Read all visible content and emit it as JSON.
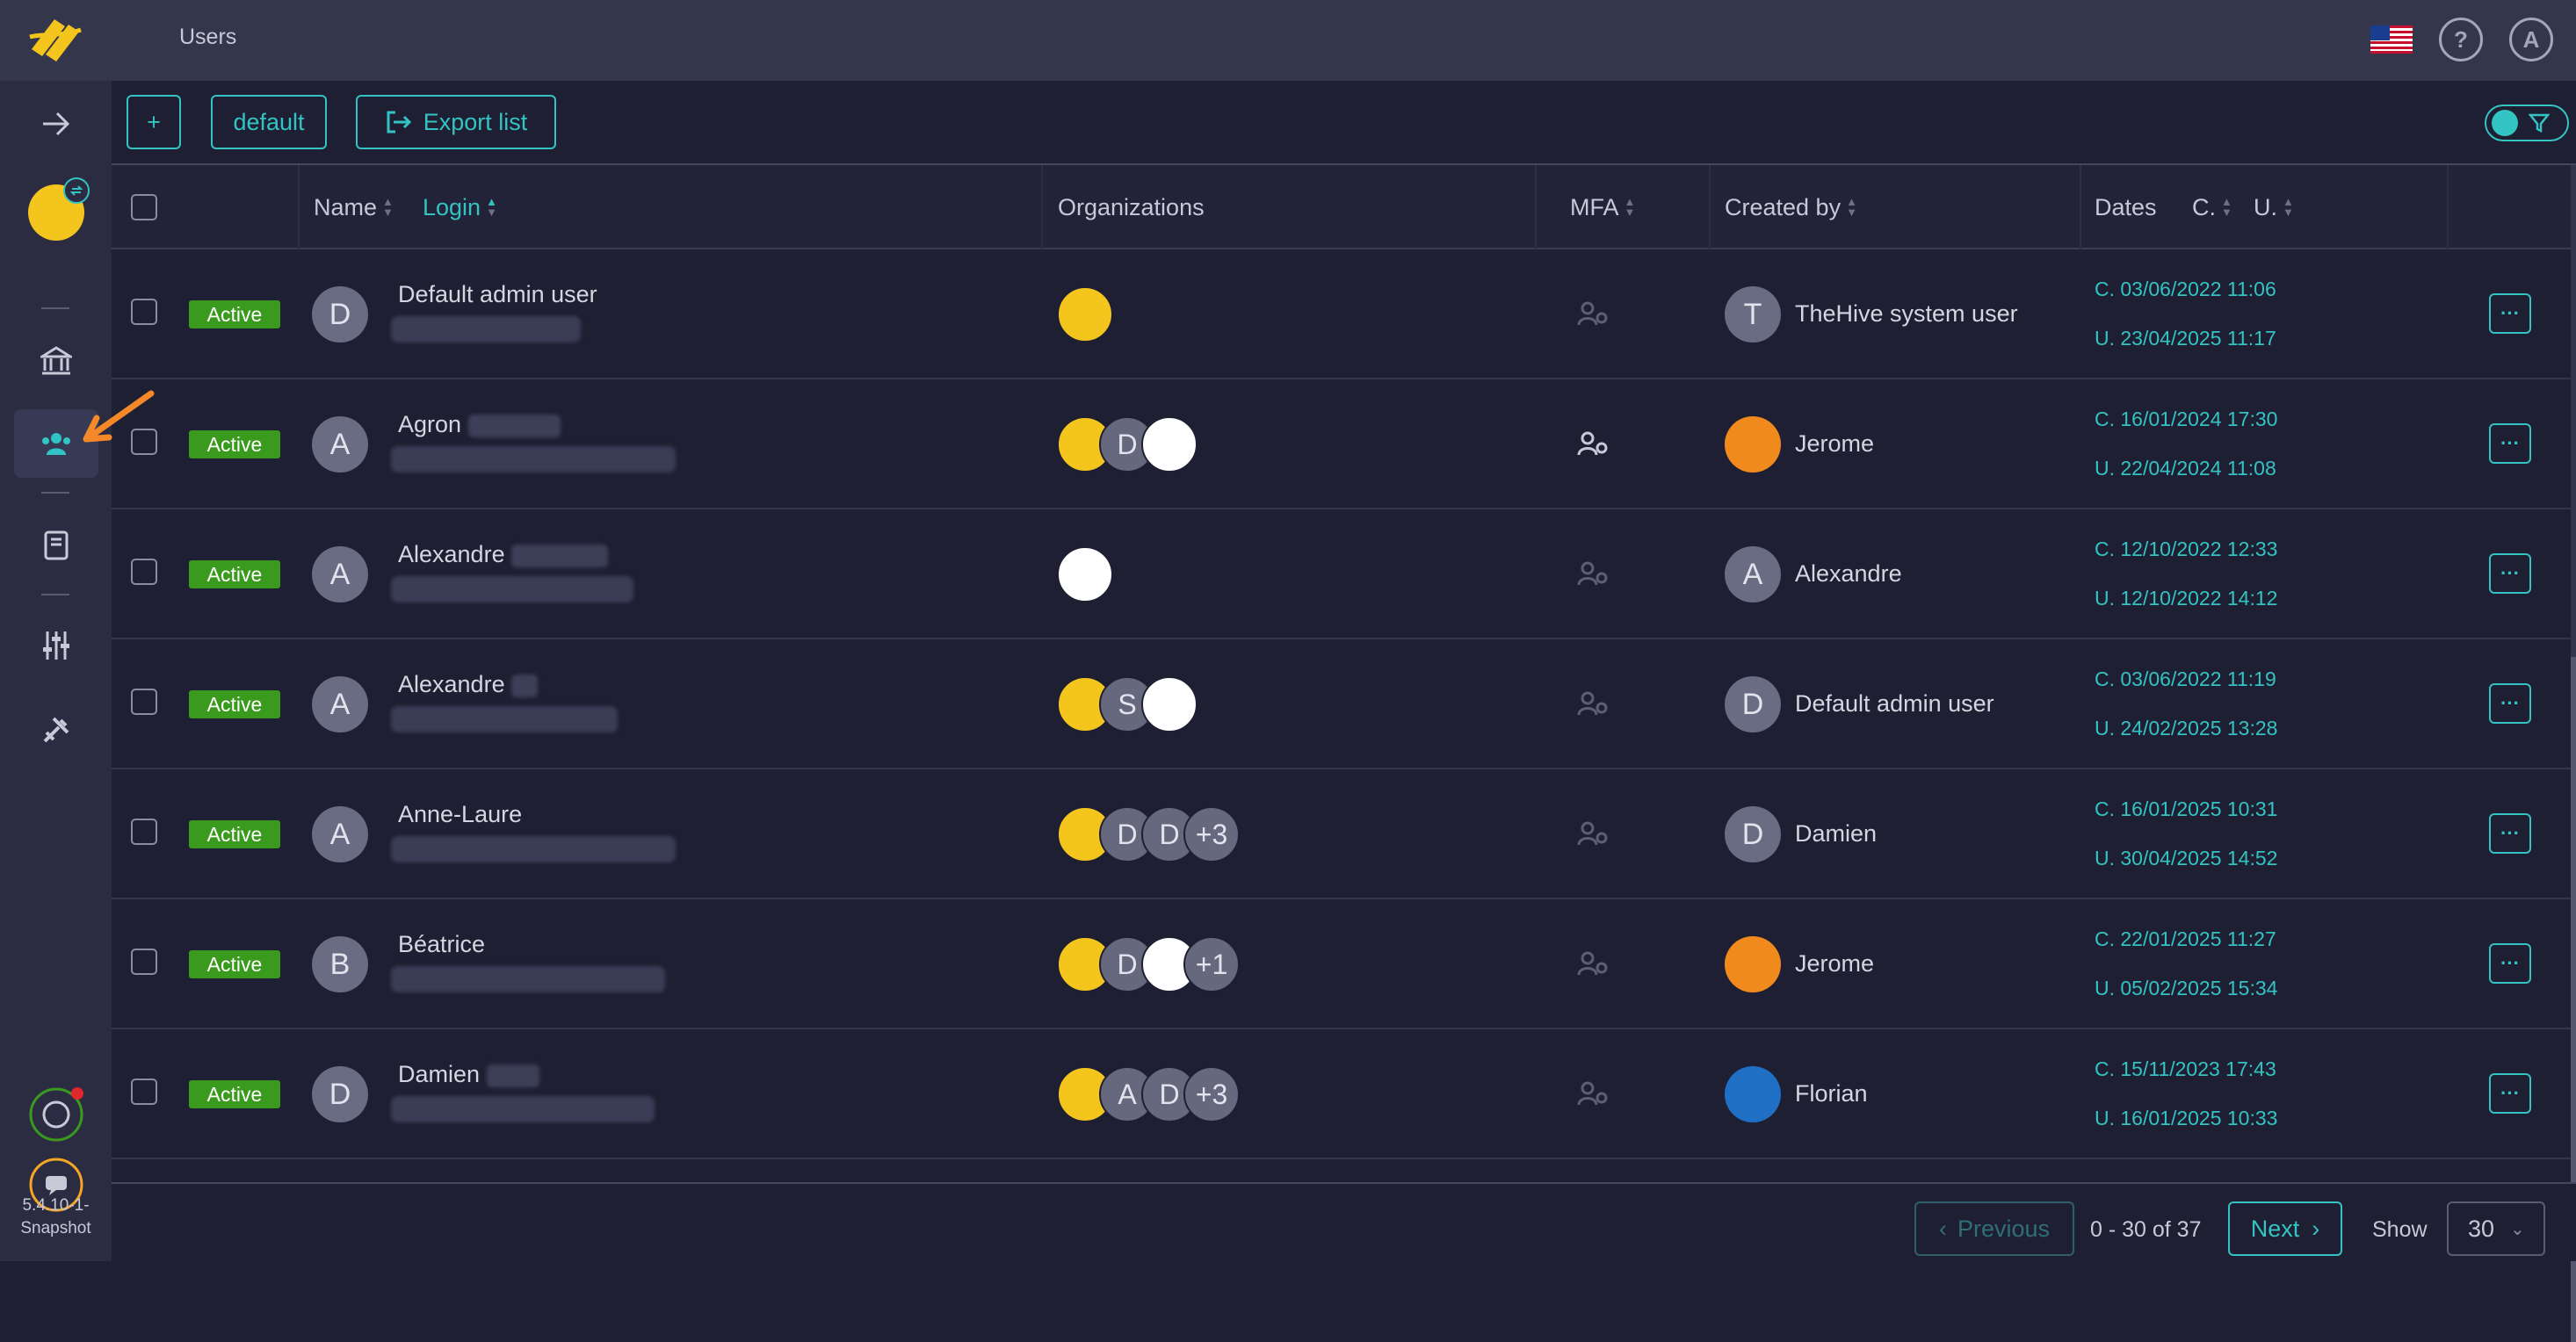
{
  "header": {
    "page_title": "Users",
    "help_glyph": "?",
    "account_initial": "A"
  },
  "toolbar": {
    "add_label": "+",
    "default_label": "default",
    "export_label": "Export list"
  },
  "columns": {
    "name": "Name",
    "login": "Login",
    "organizations": "Organizations",
    "mfa": "MFA",
    "created_by": "Created by",
    "dates": "Dates",
    "dates_c": "C.",
    "dates_u": "U."
  },
  "users": [
    {
      "status": "Active",
      "initial": "D",
      "name": "Default admin user",
      "orgs": [
        {
          "type": "yellow",
          "label": ""
        }
      ],
      "mfa": false,
      "creator_initial": "T",
      "creator_avatar": "letter",
      "creator": "TheHive system user",
      "created": "C. 03/06/2022 11:06",
      "updated": "U. 23/04/2025 11:17"
    },
    {
      "status": "Active",
      "initial": "A",
      "name": "Agron",
      "orgs": [
        {
          "type": "yellow",
          "label": ""
        },
        {
          "type": "grey",
          "label": "D"
        },
        {
          "type": "bee",
          "label": ""
        }
      ],
      "mfa": true,
      "creator_initial": "",
      "creator_avatar": "photo-orange",
      "creator": "Jerome",
      "created": "C. 16/01/2024 17:30",
      "updated": "U. 22/04/2024 11:08"
    },
    {
      "status": "Active",
      "initial": "A",
      "name": "Alexandre",
      "orgs": [
        {
          "type": "bee",
          "label": ""
        }
      ],
      "mfa": false,
      "creator_initial": "A",
      "creator_avatar": "letter",
      "creator": "Alexandre",
      "created": "C. 12/10/2022 12:33",
      "updated": "U. 12/10/2022 14:12"
    },
    {
      "status": "Active",
      "initial": "A",
      "name": "Alexandre",
      "orgs": [
        {
          "type": "yellow",
          "label": ""
        },
        {
          "type": "grey",
          "label": "S"
        },
        {
          "type": "bee",
          "label": ""
        }
      ],
      "mfa": false,
      "creator_initial": "D",
      "creator_avatar": "letter",
      "creator": "Default admin user",
      "created": "C. 03/06/2022 11:19",
      "updated": "U. 24/02/2025 13:28"
    },
    {
      "status": "Active",
      "initial": "A",
      "name": "Anne-Laure",
      "orgs": [
        {
          "type": "yellow",
          "label": ""
        },
        {
          "type": "grey",
          "label": "D"
        },
        {
          "type": "grey",
          "label": "D"
        },
        {
          "type": "grey",
          "label": "+3"
        }
      ],
      "mfa": false,
      "creator_initial": "D",
      "creator_avatar": "letter",
      "creator": "Damien",
      "created": "C. 16/01/2025 10:31",
      "updated": "U. 30/04/2025 14:52"
    },
    {
      "status": "Active",
      "initial": "B",
      "name": "Béatrice",
      "orgs": [
        {
          "type": "yellow",
          "label": ""
        },
        {
          "type": "grey",
          "label": "D"
        },
        {
          "type": "bee",
          "label": ""
        },
        {
          "type": "grey",
          "label": "+1"
        }
      ],
      "mfa": false,
      "creator_initial": "",
      "creator_avatar": "photo-orange",
      "creator": "Jerome",
      "created": "C. 22/01/2025 11:27",
      "updated": "U. 05/02/2025 15:34"
    },
    {
      "status": "Active",
      "initial": "D",
      "name": "Damien",
      "orgs": [
        {
          "type": "yellow",
          "label": ""
        },
        {
          "type": "grey",
          "label": "A"
        },
        {
          "type": "grey",
          "label": "D"
        },
        {
          "type": "grey",
          "label": "+3"
        }
      ],
      "mfa": false,
      "creator_initial": "",
      "creator_avatar": "photo-blue",
      "creator": "Florian",
      "created": "C. 15/11/2023 17:43",
      "updated": "U. 16/01/2025 10:33"
    }
  ],
  "pagination": {
    "previous_label": "Previous",
    "range": "0 - 30 of 37",
    "next_label": "Next",
    "show_label": "Show",
    "page_size": "30"
  },
  "version": {
    "line1": "5.4.10-1-",
    "line2": "Snapshot"
  },
  "colors": {
    "accent": "#33c3c3",
    "active_badge": "#3a9a1e",
    "brand_yellow": "#f4c51d",
    "annotation_arrow": "#f5892a"
  }
}
